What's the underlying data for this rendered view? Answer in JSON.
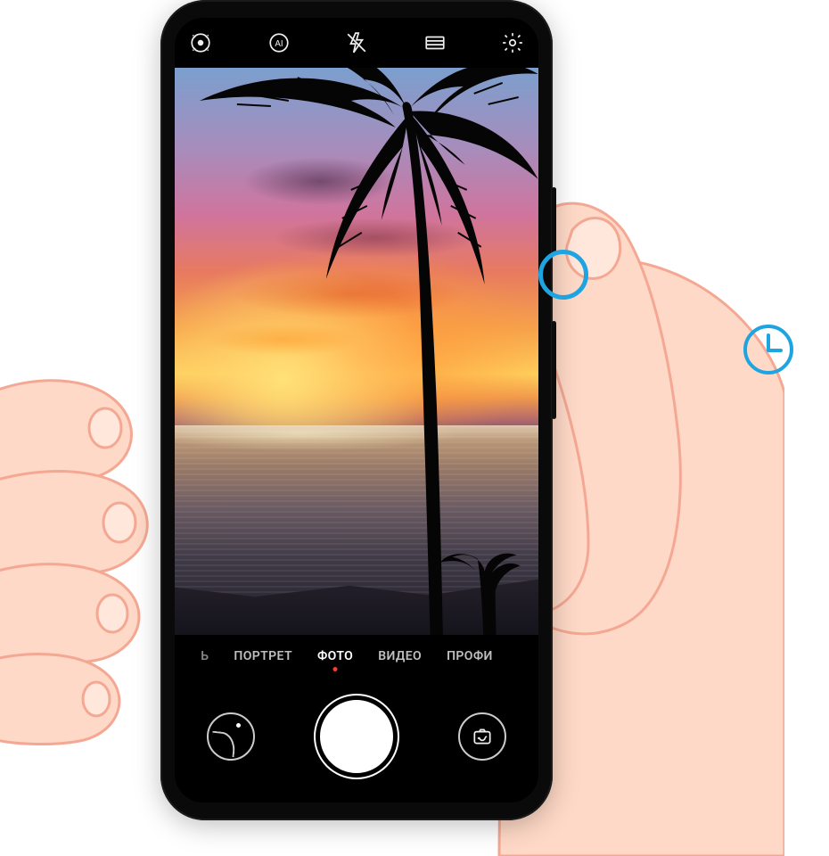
{
  "topbar": {
    "icons": {
      "lens": "motion-photo-icon",
      "ai": "ai-mode-icon",
      "flash": "flash-off-icon",
      "aspect": "aspect-ratio-icon",
      "settings": "settings-icon"
    }
  },
  "modes": {
    "items": [
      {
        "label": "Ь",
        "active": false,
        "partial": true
      },
      {
        "label": "ПОРТРЕТ",
        "active": false
      },
      {
        "label": "ФОТО",
        "active": true
      },
      {
        "label": "ВИДЕО",
        "active": false
      },
      {
        "label": "ПРОФИ",
        "active": false
      }
    ]
  },
  "controls": {
    "gallery": "gallery-button",
    "shutter": "shutter-button",
    "switch": "switch-camera-button"
  },
  "viewfinder": {
    "description": "Sunset beach with palm tree silhouette"
  },
  "hints": {
    "power_button_highlight": true,
    "clock_icon": "long-press-clock-icon"
  },
  "colors": {
    "accent": "#1ea4e0"
  }
}
